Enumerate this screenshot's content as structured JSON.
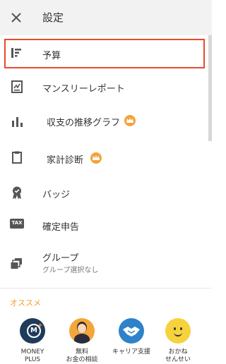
{
  "header": {
    "title": "設定"
  },
  "menu": [
    {
      "label": "予算"
    },
    {
      "label": "マンスリーレポート"
    },
    {
      "label": "収支の推移グラフ"
    },
    {
      "label": "家計診断"
    },
    {
      "label": "バッジ"
    },
    {
      "label": "確定申告",
      "icon_text": "TAX"
    },
    {
      "label": "グループ",
      "sublabel": "グループ選択なし"
    }
  ],
  "recommend": {
    "title": "オススメ",
    "apps": [
      {
        "label_line1": "MONEY",
        "label_line2": "PLUS"
      },
      {
        "label_line1": "無料",
        "label_line2": "お金の相談"
      },
      {
        "label_line1": "キャリア支援",
        "label_line2": ""
      },
      {
        "label_line1": "おかね",
        "label_line2": "せんせい"
      }
    ]
  },
  "colors": {
    "accent": "#f39c2b",
    "highlight": "#e84a2e",
    "icon": "#555555"
  }
}
